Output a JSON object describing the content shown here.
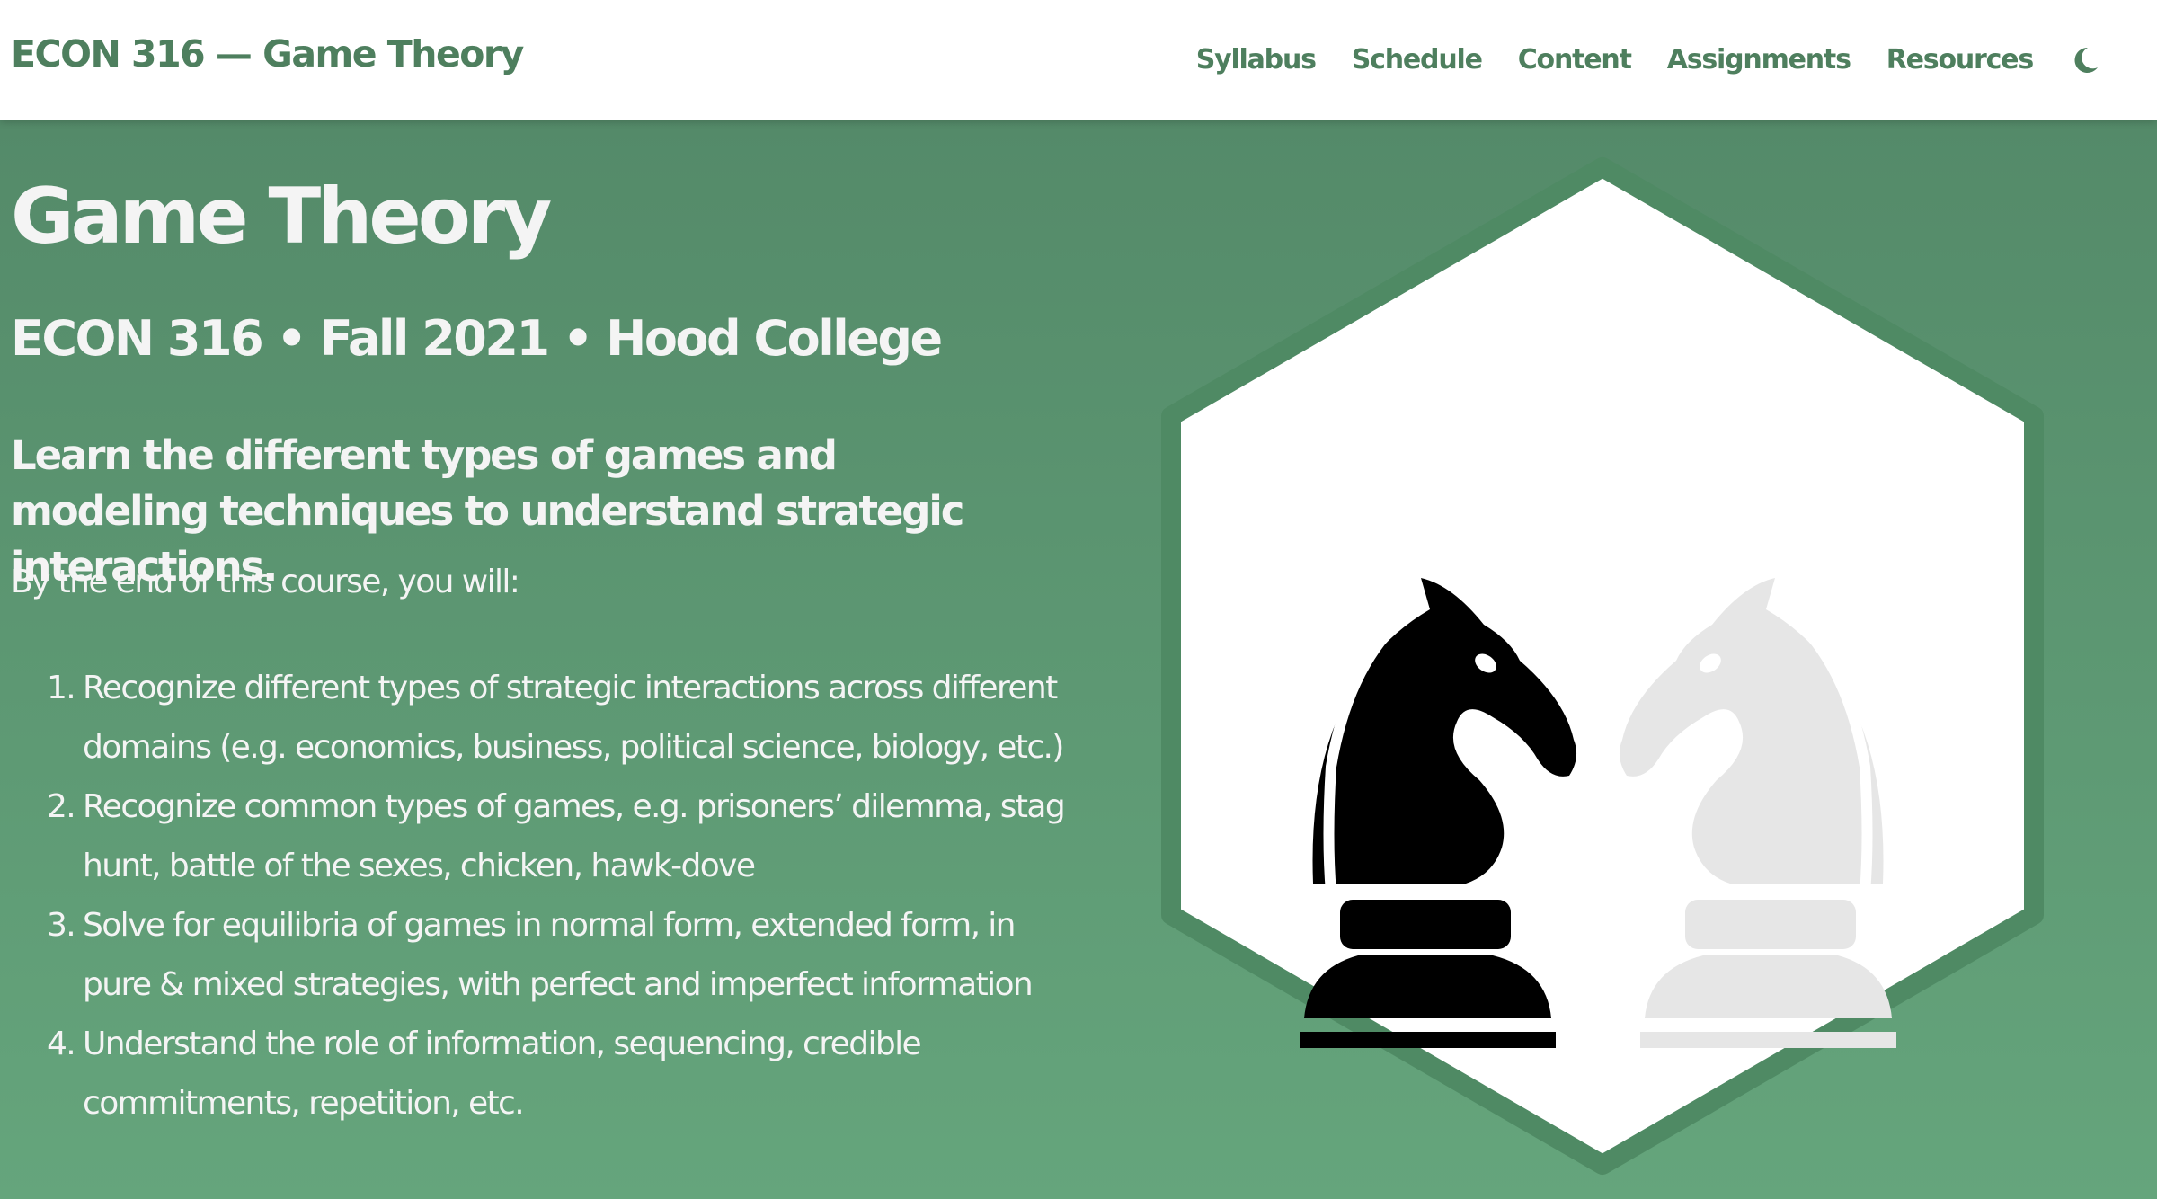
{
  "navbar": {
    "brand": "ECON 316 — Game Theory",
    "links": [
      "Syllabus",
      "Schedule",
      "Content",
      "Assignments",
      "Resources"
    ],
    "theme_toggle_icon": "moon-icon"
  },
  "hero": {
    "title": "Game Theory",
    "subtitle": "ECON 316 • Fall 2021 • Hood College",
    "lead": "Learn the different types of games and modeling techniques to understand strategic interactions.",
    "intro": "By the end of this course, you will:",
    "outcomes": [
      "Recognize different types of strategic interactions across different domains (e.g. economics, business, political science, biology, etc.)",
      "Recognize common types of games, e.g. prisoners’ dilemma, stag hunt, battle of the sexes, chicken, hawk-dove",
      "Solve for equilibria of games in normal form, extended form, in pure & mixed strategies, with perfect and imperfect information",
      "Understand the role of information, sequencing, credible commitments, repetition, etc."
    ],
    "logo": {
      "icon": "chess-knights-icon",
      "pieces": [
        "black-knight",
        "white-knight"
      ]
    }
  },
  "colors": {
    "accent": "#4e7f5e",
    "hero_top": "#548a69",
    "hero_bottom": "#65a57c",
    "hex_border": "#4f8a64",
    "white_knight": "#e6e6e6",
    "black_knight": "#000000"
  }
}
